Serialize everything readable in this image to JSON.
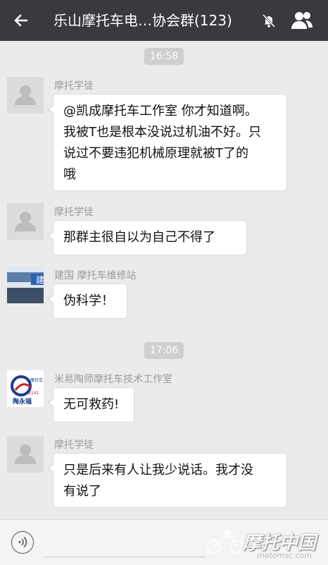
{
  "header": {
    "title": "乐山摩托车电…协会群(123)",
    "back_icon": "back-arrow-icon",
    "mute_icon": "bell-muted-icon",
    "members_icon": "group-members-icon"
  },
  "timestamps": [
    "16:58",
    "17:06"
  ],
  "messages": [
    {
      "sender": "摩托学徒",
      "text_lines": [
        "@凯成摩托车工作室  你才知道啊。",
        "我被T也是根本没说过机油不好。只",
        "说过不要违犯机械原理就被T了的",
        "哦"
      ]
    },
    {
      "sender": "摩托学徒",
      "text_lines": [
        "那群主很自以为自己不得了"
      ]
    },
    {
      "sender": "建国 摩托车维修站",
      "text_lines": [
        "伪科学！"
      ],
      "avatar_text": "建"
    },
    {
      "sender": "米易陶师摩托车技术工作室",
      "text_lines": [
        "无可救药!"
      ],
      "avatar_text": "陶永福",
      "avatar_small_text": "摩托车",
      "avatar_num": "2141"
    },
    {
      "sender": "摩托学徒",
      "text_lines": [
        "只是后来有人让我少说话。我才没",
        "有说了"
      ]
    }
  ],
  "bottom": {
    "voice_icon": "voice-icon",
    "watermark": "摩托中国",
    "watermark_url": "motomsc.com"
  },
  "colors": {
    "topbar": "#393a3f",
    "background": "#ebebeb",
    "bubble": "#ffffff"
  }
}
